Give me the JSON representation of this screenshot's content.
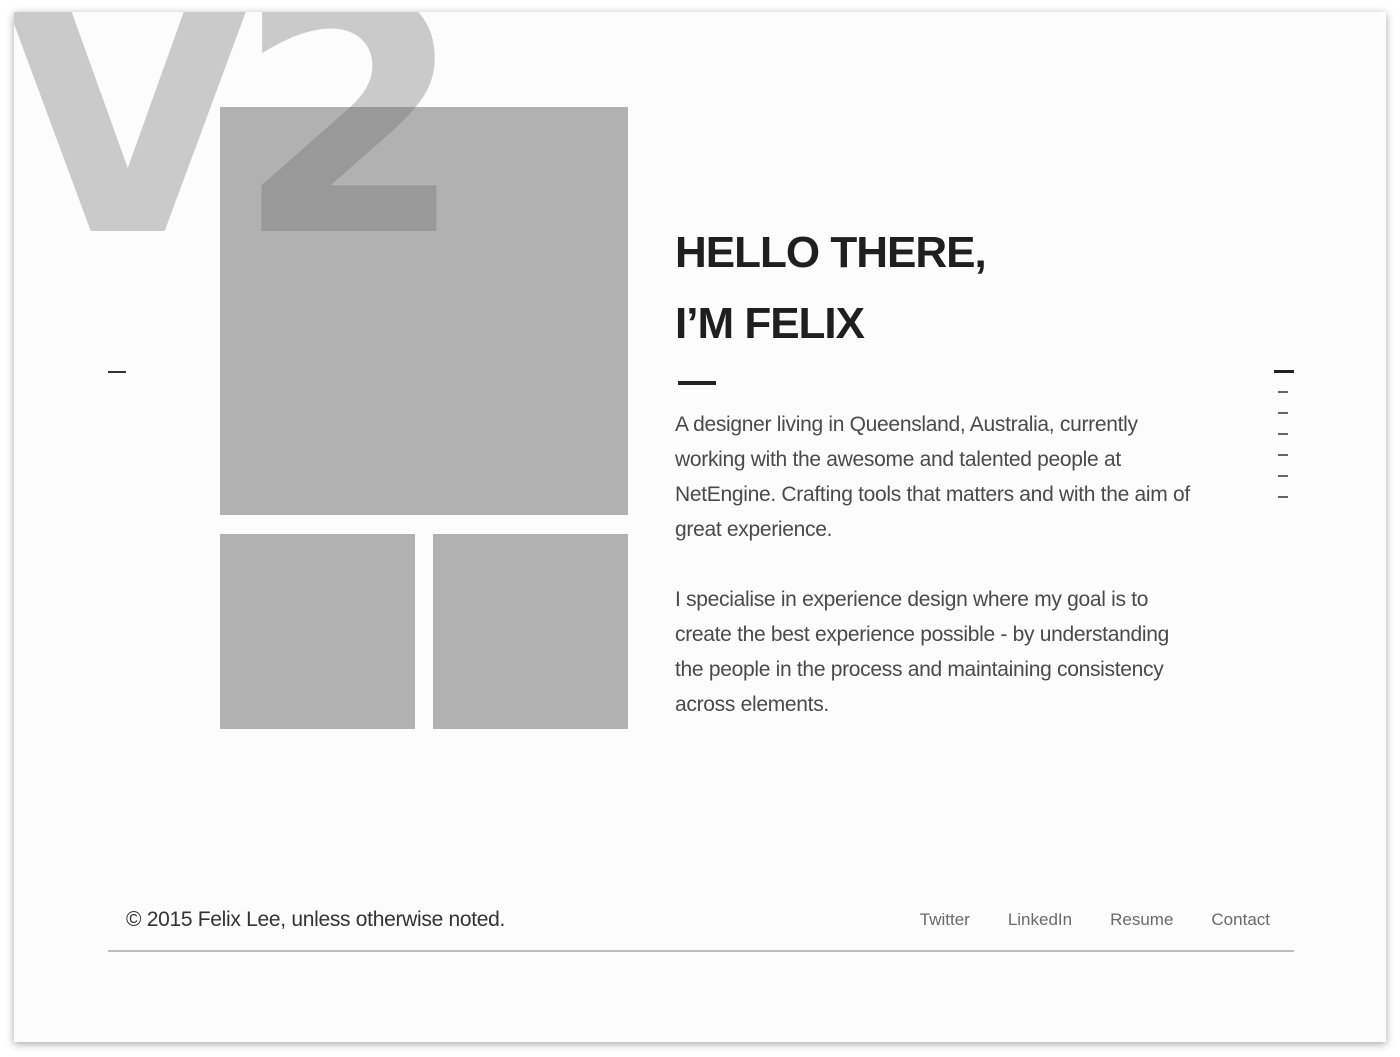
{
  "watermark": "V2",
  "hero": {
    "headline_line1": "HELLO THERE,",
    "headline_line2": "I’M FELIX",
    "paragraph1": "A designer living in Queensland, Australia, currently working with the awesome and talented people at NetEngine. Crafting tools that matters and with the aim of great experience.",
    "paragraph2": "I specialise in experience design where my goal is to create the best experience possible - by understanding the people in the process and maintaining consistency across elements."
  },
  "pager": {
    "count": 7,
    "active_index": 0
  },
  "footer": {
    "copyright": "© 2015 Felix Lee, unless otherwise noted.",
    "links": [
      "Twitter",
      "LinkedIn",
      "Resume",
      "Contact"
    ]
  },
  "colors": {
    "background": "#fcfcfc",
    "placeholder_image": "#b1b1b1",
    "heading": "#1f1f1f",
    "body_text": "#4a4a4a"
  }
}
